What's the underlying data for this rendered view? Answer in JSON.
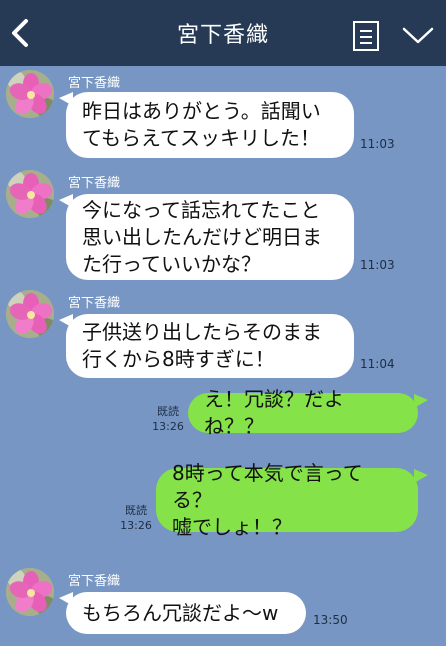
{
  "header": {
    "title": "宮下香織",
    "back_icon": "chevron-left-icon",
    "notes_icon": "notes-icon",
    "menu_icon": "chevron-down-icon",
    "background": "#263a56"
  },
  "chat_background": "#7796c3",
  "colors": {
    "incoming_bubble": "#ffffff",
    "outgoing_bubble": "#85e249"
  },
  "messages": [
    {
      "direction": "incoming",
      "sender": "宮下香織",
      "text": "昨日はありがとう。話聞い\nてもらえてスッキリした！",
      "time": "11:03"
    },
    {
      "direction": "incoming",
      "sender": "宮下香織",
      "text": "今になって話忘れてたこと\n思い出したんだけど明日ま\nた行っていいかな？",
      "time": "11:03"
    },
    {
      "direction": "incoming",
      "sender": "宮下香織",
      "text": "子供送り出したらそのまま\n行くから8時すぎに！",
      "time": "11:04"
    },
    {
      "direction": "outgoing",
      "read": "既読",
      "text": "え！冗談？だよね？？",
      "time": "13:26"
    },
    {
      "direction": "outgoing",
      "read": "既読",
      "text": "8時って本気で言ってる？\n嘘でしょ！？",
      "time": "13:26"
    },
    {
      "direction": "incoming",
      "sender": "宮下香織",
      "text": "もちろん冗談だよ〜w",
      "time": "13:50"
    }
  ]
}
